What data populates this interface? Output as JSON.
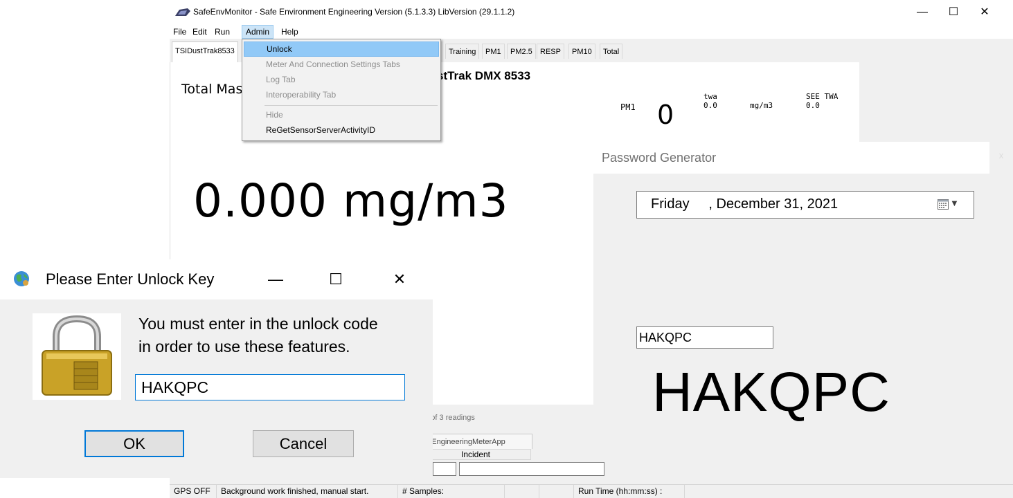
{
  "main_window": {
    "title": "SafeEnvMonitor - Safe Environment Engineering Version (5.1.3.3) LibVersion (29.1.1.2)",
    "controls": {
      "minimize": "—",
      "maximize": "☐",
      "close": "✕"
    },
    "menu": [
      "File",
      "Edit",
      "Run",
      "Admin",
      "Help"
    ],
    "tabs": [
      "TSIDustTrak8533",
      "Training",
      "PM1",
      "PM2.5",
      "RESP",
      "PM10",
      "Total"
    ],
    "content": {
      "device_title": "stTrak DMX 8533",
      "total_mass_label": "Total Mas",
      "pm1_label": "PM1",
      "pm1_value": "0",
      "twa_label": "twa",
      "twa_value": "0.0",
      "unit": "mg/m3",
      "see_twa_label": "SEE TWA",
      "see_twa_value": "0.0",
      "big_reading": "0.000 mg/m3"
    },
    "lower": {
      "readings_text": "ge of 3 readings",
      "app_tab_label": "entEngineeringMeterApp",
      "incident_header": "Incident"
    },
    "status_bar": {
      "gps": "GPS OFF",
      "message": "Background work finished, manual start.",
      "samples_label": "# Samples:",
      "runtime_label": "Run Time (hh:mm:ss) :"
    }
  },
  "admin_menu": {
    "items": [
      {
        "label": "Unlock",
        "enabled": true
      },
      {
        "label": "Meter And Connection Settings Tabs",
        "enabled": false
      },
      {
        "label": "Log Tab",
        "enabled": false
      },
      {
        "label": "Interoperability Tab",
        "enabled": false
      },
      {
        "label": "Hide",
        "enabled": false
      },
      {
        "label": "ReGetSensorServerActivityID",
        "enabled": true
      }
    ]
  },
  "password_generator": {
    "title": "Password Generator",
    "close": "x",
    "date_value": "Friday     , December 31, 2021",
    "code_input": "HAKQPC",
    "big_code": "HAKQPC"
  },
  "unlock_dialog": {
    "title": "Please Enter Unlock Key",
    "controls": {
      "minimize": "—",
      "maximize": "☐",
      "close": "✕"
    },
    "message_line1": "You must enter in the unlock code",
    "message_line2": "in order to use these features.",
    "input_value": "HAKQPC",
    "ok_label": "OK",
    "cancel_label": "Cancel"
  },
  "colors": {
    "menu_highlight": "#91c9f7",
    "focus_border": "#0078d7",
    "window_bg": "#f0f0f0"
  }
}
